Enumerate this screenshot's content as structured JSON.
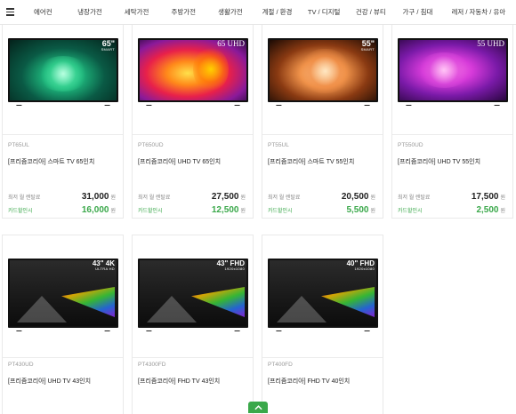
{
  "nav": {
    "items": [
      "에어컨",
      "냉장가전",
      "세탁가전",
      "주방가전",
      "생활가전",
      "계절 / 환경",
      "TV / 디지털",
      "건강 / 뷰티",
      "가구 / 침대",
      "레저 / 자동차 / 유아"
    ]
  },
  "products": [
    {
      "code": "PT65UL",
      "title": "[프리즘코리아] 스마트 TV 65인치",
      "rent_label": "최저 월 렌탈료",
      "rent_price": "31,000",
      "card_label": "카드할인시",
      "card_price": "16,000",
      "won": "원",
      "badge": "65\"",
      "badge_sub": "SMART",
      "screen_style": "green-smoke"
    },
    {
      "code": "PT650UD",
      "title": "[프리즘코리아] UHD TV 65인치",
      "rent_label": "최저 월 렌탈료",
      "rent_price": "27,500",
      "card_label": "카드할인시",
      "card_price": "12,500",
      "won": "원",
      "badge": "65 UHD",
      "badge_sub": "",
      "screen_style": "fire"
    },
    {
      "code": "PT55UL",
      "title": "[프리즘코리아] 스마트 TV 55인치",
      "rent_label": "최저 월 렌탈료",
      "rent_price": "20,500",
      "card_label": "카드할인시",
      "card_price": "5,500",
      "won": "원",
      "badge": "55\"",
      "badge_sub": "SMART",
      "screen_style": "orange-smoke"
    },
    {
      "code": "PT550UD",
      "title": "[프리즘코리아] UHD TV 55인치",
      "rent_label": "최저 월 렌탈료",
      "rent_price": "17,500",
      "card_label": "카드할인시",
      "card_price": "2,500",
      "won": "원",
      "badge": "55 UHD",
      "badge_sub": "",
      "screen_style": "purple"
    },
    {
      "code": "PT430UD",
      "title": "[프리즘코리아] UHD TV 43인치",
      "badge": "43\"",
      "badge_res": "4K",
      "badge_sub": "ULTRA HD",
      "screen_style": "prism"
    },
    {
      "code": "PT4300FD",
      "title": "[프리즘코리아] FHD TV 43인치",
      "badge": "43\"",
      "badge_res": "FHD",
      "badge_sub": "1920x1080",
      "screen_style": "prism"
    },
    {
      "code": "PT400FD",
      "title": "[프리즘코리아] FHD TV 40인치",
      "badge": "40\"",
      "badge_res": "FHD",
      "badge_sub": "1920x1080",
      "screen_style": "prism"
    }
  ]
}
